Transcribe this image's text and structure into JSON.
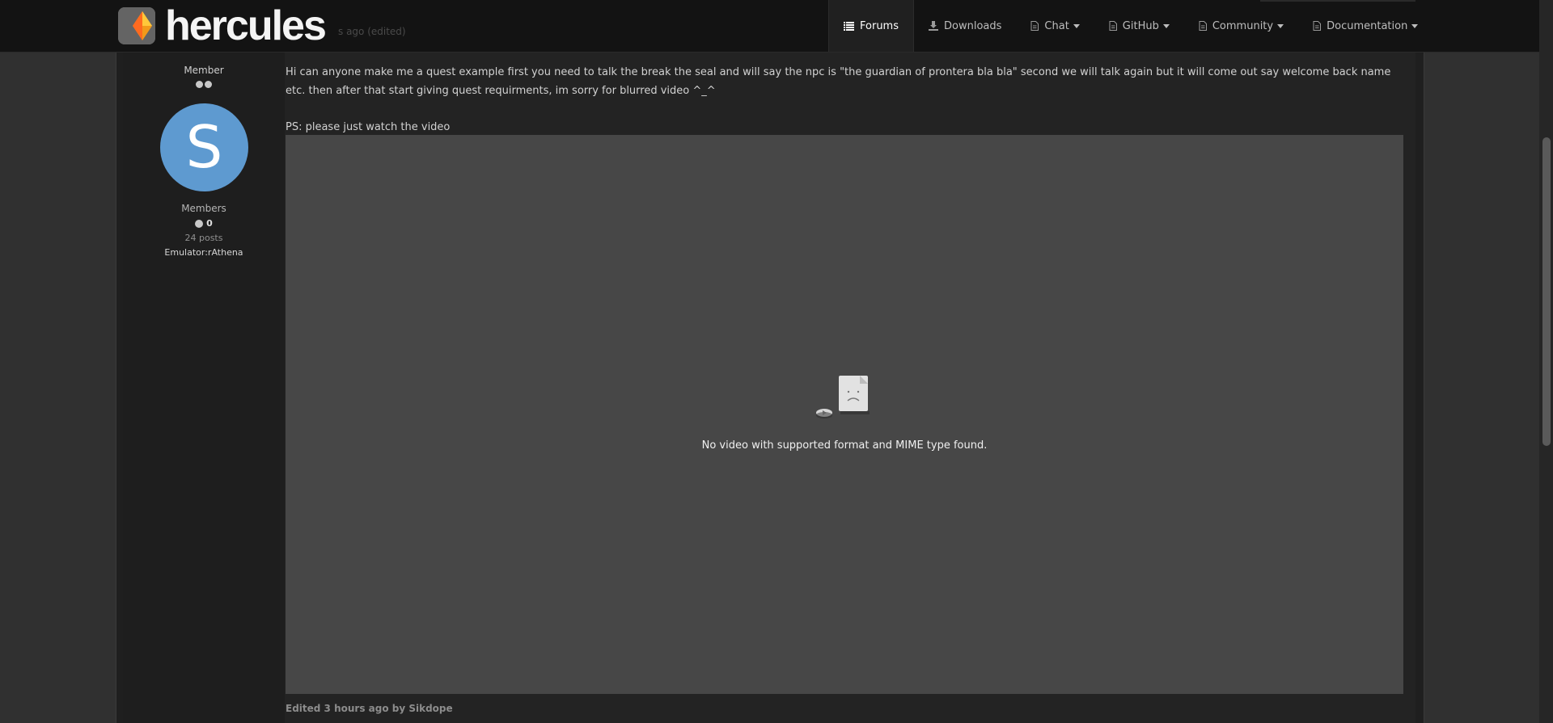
{
  "header": {
    "brand": "hercules",
    "ghost_text": "s ago (edited)",
    "nav": [
      {
        "label": "Forums",
        "icon": "list-icon",
        "active": true
      },
      {
        "label": "Downloads",
        "icon": "download-icon"
      },
      {
        "label": "Chat",
        "icon": "page-icon"
      },
      {
        "label": "GitHub",
        "icon": "page-icon"
      },
      {
        "label": "Community",
        "icon": "page-icon"
      },
      {
        "label": "Documentation",
        "icon": "page-icon"
      }
    ]
  },
  "author": {
    "rank_title": "Member",
    "rank_pips": 2,
    "avatar_letter": "S",
    "avatar_color": "#5e9ad0",
    "group": "Members",
    "reputation": "0",
    "posts": "24 posts",
    "emulator": "Emulator:rAthena"
  },
  "post": {
    "body": "Hi can anyone make me a quest example first you need to talk the break the seal  and will say the npc is \"the guardian of prontera bla bla\" second we will talk again but it will come out say welcome back name etc.  then after that start giving quest requirments, im sorry for blurred video ^_^",
    "ps": "PS: please just watch the video",
    "video_error": "No video with supported format and MIME type found.",
    "edited": "Edited 3 hours ago by Sikdope"
  }
}
